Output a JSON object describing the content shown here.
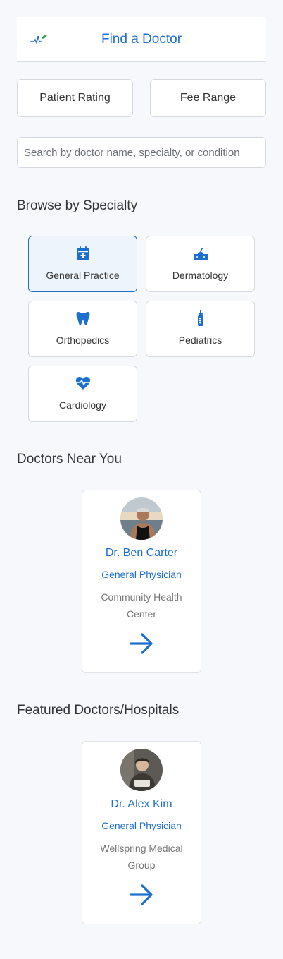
{
  "header": {
    "title": "Find a Doctor",
    "logo_icon": "vital-sign-logo-icon"
  },
  "filters": {
    "rating_label": "Patient Rating",
    "fee_label": "Fee Range"
  },
  "search": {
    "placeholder": "Search by doctor name, specialty, or condition",
    "value": ""
  },
  "specialty": {
    "title": "Browse by Specialty",
    "selected": "General Practice",
    "items": [
      {
        "label": "General Practice",
        "icon": "calendar-plus-icon"
      },
      {
        "label": "Dermatology",
        "icon": "skin-icon"
      },
      {
        "label": "Orthopedics",
        "icon": "tooth-icon"
      },
      {
        "label": "Pediatrics",
        "icon": "baby-bottle-icon"
      },
      {
        "label": "Cardiology",
        "icon": "heart-pulse-icon"
      }
    ]
  },
  "near": {
    "title": "Doctors Near You",
    "doctors": [
      {
        "name": "Dr. Ben Carter",
        "specialty": "General Physician",
        "location": "Community Health Center"
      }
    ]
  },
  "featured": {
    "title": "Featured Doctors/Hospitals",
    "doctors": [
      {
        "name": "Dr. Alex Kim",
        "specialty": "General Physician",
        "location": "Wellspring Medical Group"
      }
    ]
  },
  "colors": {
    "accent": "#1d6fcf",
    "background": "#f6f8fb",
    "logo_green": "#3aa847"
  }
}
